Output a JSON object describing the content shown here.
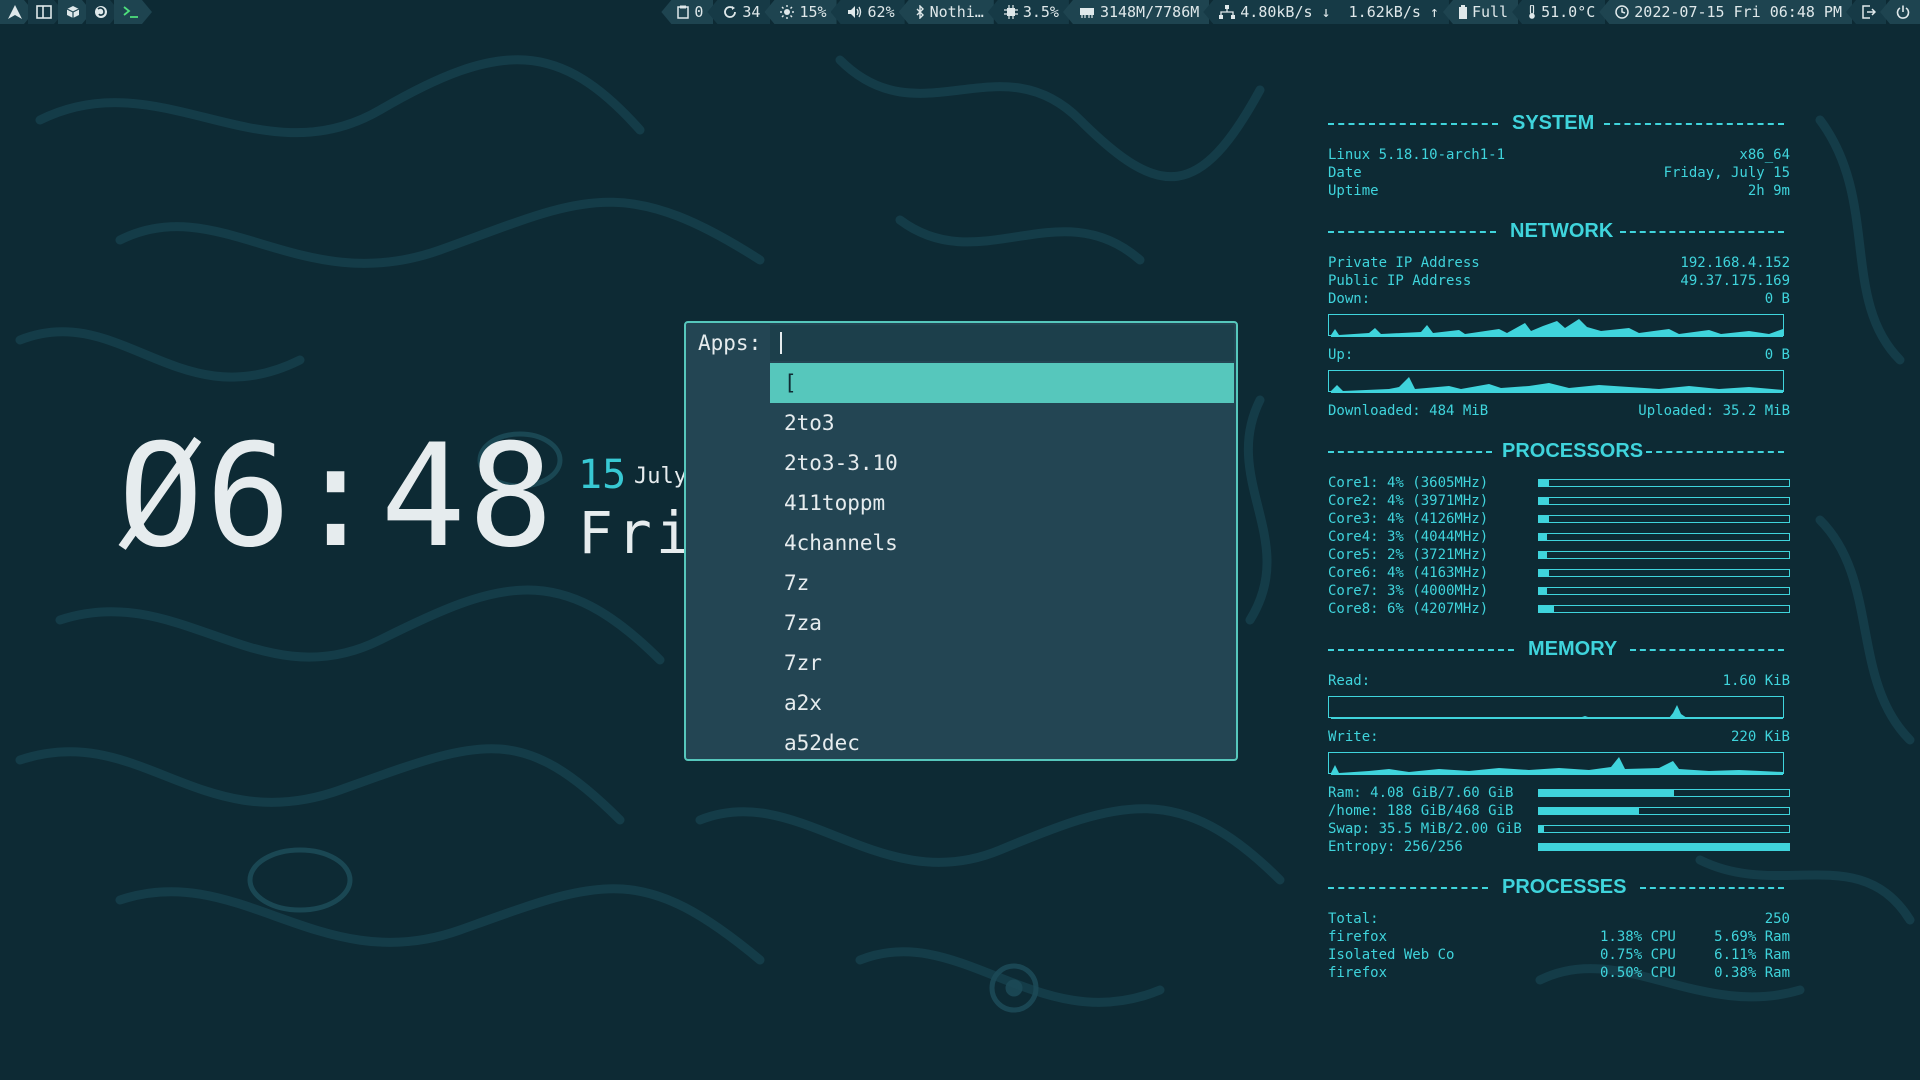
{
  "topbar": {
    "left": [
      {
        "icon": "arch-logo-icon"
      },
      {
        "icon": "sidebar-toggle-icon"
      },
      {
        "icon": "package-icon"
      },
      {
        "icon": "firefox-icon"
      },
      {
        "icon": "terminal-icon",
        "active": true
      }
    ],
    "right": [
      {
        "icon": "clipboard-icon",
        "text": "0"
      },
      {
        "icon": "updates-icon",
        "text": "34"
      },
      {
        "icon": "brightness-icon",
        "text": "15%"
      },
      {
        "icon": "volume-icon",
        "text": "62%"
      },
      {
        "icon": "bluetooth-icon",
        "text": "Nothi…"
      },
      {
        "icon": "cpu-icon",
        "text": "3.5%"
      },
      {
        "icon": "memory-icon",
        "text": "3148M/7786M"
      },
      {
        "icon": "network-icon",
        "text": "4.80kB/s ↓  1.62kB/s ↑"
      },
      {
        "icon": "battery-icon",
        "text": "Full"
      },
      {
        "icon": "thermometer-icon",
        "text": "51.0°C"
      },
      {
        "icon": "clock-icon",
        "text": "2022-07-15 Fri 06:48 PM"
      },
      {
        "icon": "logout-icon",
        "text": ""
      },
      {
        "icon": "power-icon",
        "text": ""
      }
    ]
  },
  "clock": {
    "time": "Ø6:48",
    "day": "15",
    "month": "July",
    "weekday": "Fri"
  },
  "launcher": {
    "prompt": "Apps:",
    "input": "",
    "items": [
      "[",
      "2to3",
      "2to3-3.10",
      "411toppm",
      "4channels",
      "7z",
      "7za",
      "7zr",
      "a2x",
      "a52dec"
    ],
    "selected": 0
  },
  "conky": {
    "system": {
      "title": "SYSTEM",
      "kernel": "Linux 5.18.10-arch1-1",
      "arch": "x86_64",
      "date_label": "Date",
      "date": "Friday, July 15",
      "uptime_label": "Uptime",
      "uptime": "2h 9m"
    },
    "network": {
      "title": "NETWORK",
      "private_label": "Private IP Address",
      "private_ip": "192.168.4.152",
      "public_label": "Public IP Address",
      "public_ip": "49.37.175.169",
      "down_label": "Down:",
      "down": "0 B",
      "up_label": "Up:",
      "up": "0 B",
      "downloaded": "Downloaded: 484 MiB",
      "uploaded": "Uploaded: 35.2 MiB"
    },
    "processors": {
      "title": "PROCESSORS",
      "cores": [
        {
          "label": "Core1: 4% (3605MHz)",
          "pct": 4
        },
        {
          "label": "Core2: 4% (3971MHz)",
          "pct": 4
        },
        {
          "label": "Core3: 4% (4126MHz)",
          "pct": 4
        },
        {
          "label": "Core4: 3% (4044MHz)",
          "pct": 3
        },
        {
          "label": "Core5: 2% (3721MHz)",
          "pct": 2
        },
        {
          "label": "Core6: 4% (4163MHz)",
          "pct": 4
        },
        {
          "label": "Core7: 3% (4000MHz)",
          "pct": 3
        },
        {
          "label": "Core8: 6% (4207MHz)",
          "pct": 6
        }
      ]
    },
    "memory": {
      "title": "MEMORY",
      "read_label": "Read:",
      "read": "1.60 KiB",
      "write_label": "Write:",
      "write": "220 KiB",
      "bars": [
        {
          "label": "Ram: 4.08 GiB/7.60 GiB",
          "pct": 54
        },
        {
          "label": "/home: 188 GiB/468 GiB",
          "pct": 40
        },
        {
          "label": "Swap: 35.5 MiB/2.00 GiB",
          "pct": 2
        },
        {
          "label": "Entropy: 256/256",
          "pct": 100
        }
      ]
    },
    "processes": {
      "title": "PROCESSES",
      "total_label": "Total:",
      "total": "250",
      "rows": [
        {
          "name": "firefox",
          "cpu": "1.38% CPU",
          "ram": "5.69% Ram"
        },
        {
          "name": "Isolated Web Co",
          "cpu": "0.75% CPU",
          "ram": "6.11% Ram"
        },
        {
          "name": "firefox",
          "cpu": "0.50% CPU",
          "ram": "0.38% Ram"
        }
      ]
    }
  },
  "colors": {
    "background": "#0d2a34",
    "accent": "#3fd4dc",
    "selection": "#56c7bc",
    "text": "#e6ecee"
  }
}
